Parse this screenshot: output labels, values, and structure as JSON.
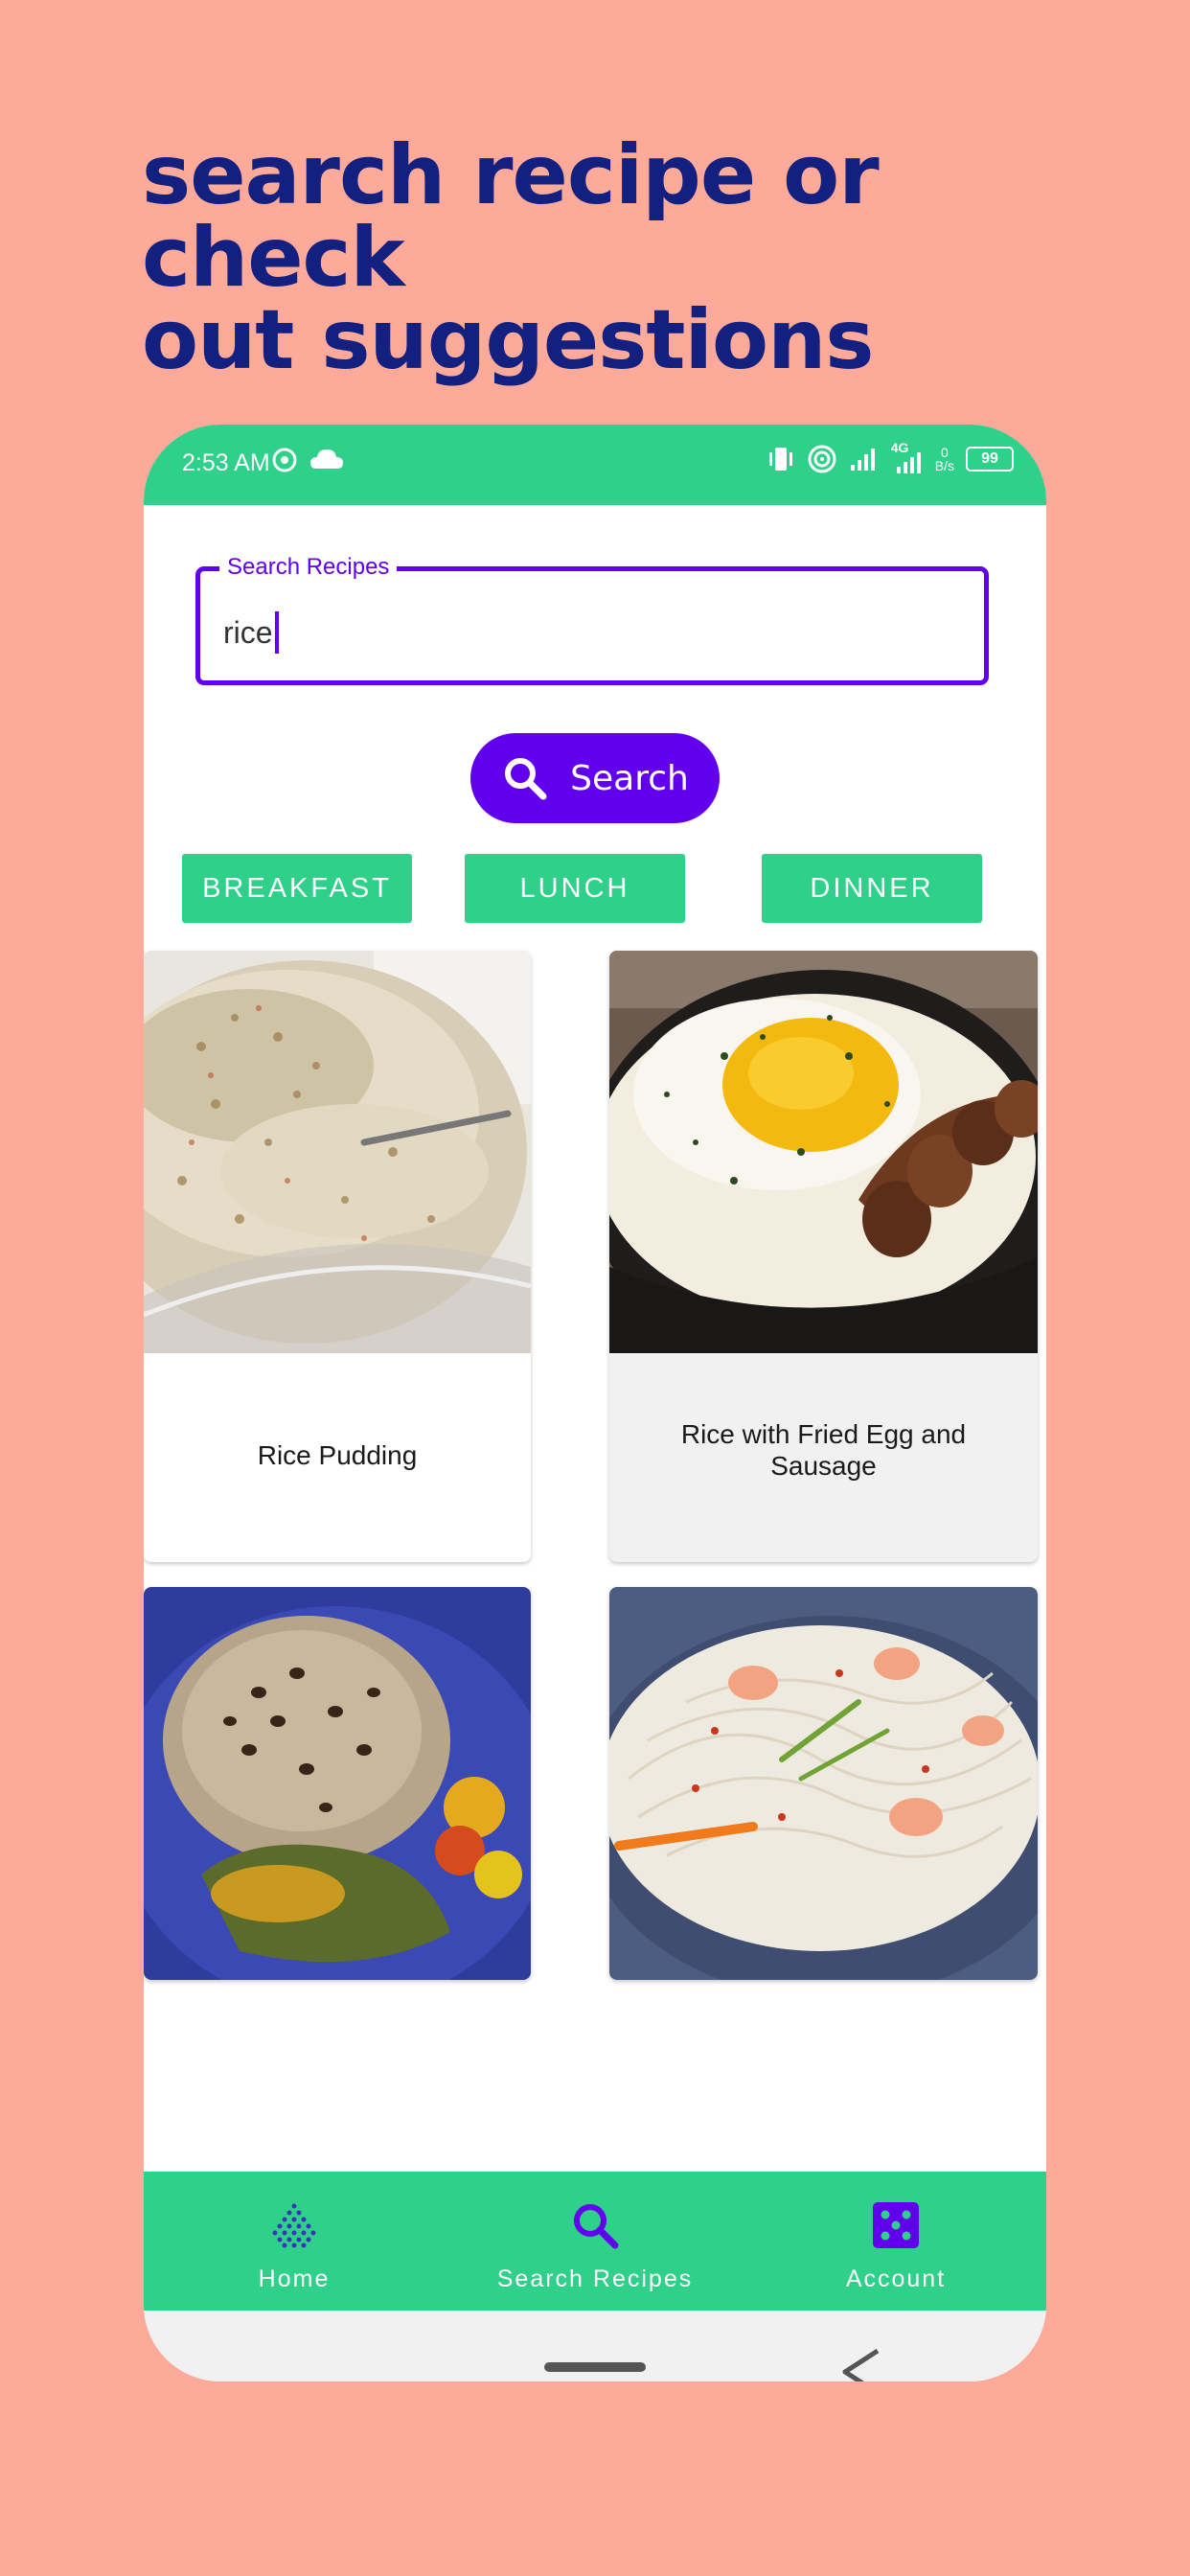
{
  "headline": {
    "line1": "search recipe or check",
    "line2": "out suggestions"
  },
  "status_bar": {
    "time": "2:53 AM",
    "network_label": "4G",
    "net_speed_value": "0",
    "net_speed_unit": "B/s",
    "battery": "99"
  },
  "search": {
    "label": "Search Recipes",
    "value": "rice",
    "button_label": "Search"
  },
  "categories": [
    "BREAKFAST",
    "LUNCH",
    "DINNER"
  ],
  "recipes": [
    {
      "title": "Rice Pudding"
    },
    {
      "title": "Rice with Fried Egg and Sausage"
    },
    {
      "title": ""
    },
    {
      "title": ""
    }
  ],
  "bottom_nav": [
    {
      "label": "Home",
      "icon": "home-icon"
    },
    {
      "label": "Search Recipes",
      "icon": "search-icon"
    },
    {
      "label": "Account",
      "icon": "dice-icon"
    }
  ],
  "colors": {
    "background": "#fdaa9a",
    "headline": "#13207f",
    "brand_green": "#2fd08a",
    "accent_purple": "#6200ee"
  }
}
